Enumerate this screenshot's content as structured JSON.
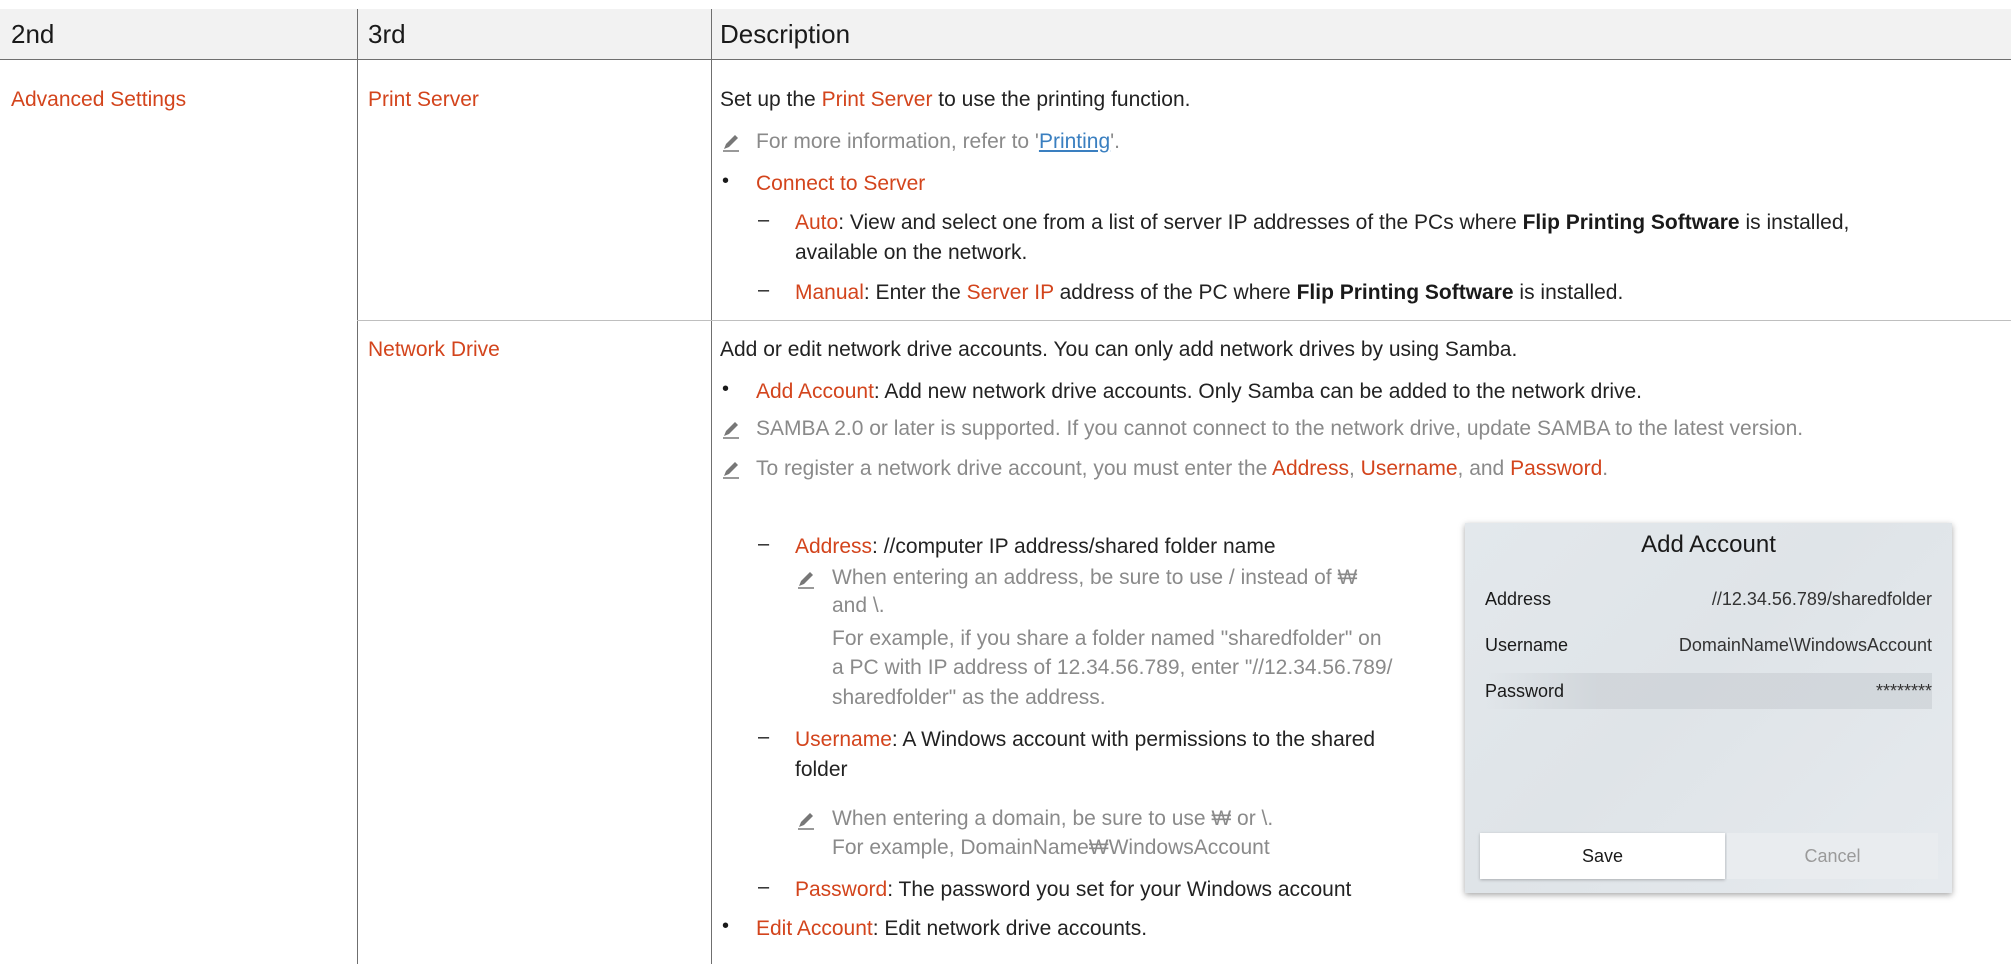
{
  "table": {
    "headers": {
      "col2": "2nd",
      "col3": "3rd",
      "col4": "Description"
    },
    "section": "Advanced Settings",
    "print_server": {
      "name": "Print Server",
      "intro_a": "Set up the ",
      "intro_hl": "Print Server",
      "intro_b": " to use the printing function.",
      "note_a": "For more information, refer to '",
      "note_link": "Printing",
      "note_b": "'.",
      "bullet": "Connect to Server",
      "auto_label": "Auto",
      "auto_a": ": View and select one from a list of server IP addresses of the PCs where ",
      "auto_bold": "Flip Printing Software",
      "auto_b": " is installed,",
      "auto_line2": "available on the network.",
      "manual_label": "Manual",
      "manual_a": ": Enter the ",
      "manual_hl": "Server IP",
      "manual_b": " address of the PC where ",
      "manual_bold": "Flip Printing Software",
      "manual_c": " is installed."
    },
    "network_drive": {
      "name": "Network Drive",
      "intro": "Add or edit network drive accounts. You can only add network drives by using Samba.",
      "add_label": "Add Account",
      "add_text": ": Add new network drive accounts. Only Samba can be added to the network drive.",
      "note1": "SAMBA 2.0 or later is supported. If you cannot connect to the network drive, update SAMBA to the latest version.",
      "note2_a": "To register a network drive account, you must enter the ",
      "note2_address": "Address",
      "note2_sep1": ", ",
      "note2_username": "Username",
      "note2_sep2": ", and ",
      "note2_password": "Password",
      "note2_end": ".",
      "address_label": "Address",
      "address_text": ": //computer IP address/shared folder name",
      "address_note_l1": "When entering an address, be sure to use / instead of ₩",
      "address_note_l2": "and \\.",
      "address_note_l3": "For example, if you share a folder named \"sharedfolder\" on",
      "address_note_l4": "a PC with IP address of 12.34.56.789, enter \"//12.34.56.789/",
      "address_note_l5": "sharedfolder\" as the address.",
      "username_label": "Username",
      "username_text": ": A Windows account with permissions to the shared",
      "username_line2": "folder",
      "username_note_l1": "When entering a domain, be sure to use ₩ or \\.",
      "username_note_l2": "For example, DomainName₩WindowsAccount",
      "password_label": "Password",
      "password_text": ": The password you set for your Windows account",
      "edit_label": "Edit Account",
      "edit_text": ": Edit network drive accounts."
    }
  },
  "dialog": {
    "title": "Add Account",
    "address_label": "Address",
    "address_value": "//12.34.56.789/sharedfolder",
    "username_label": "Username",
    "username_value": "DomainName\\WindowsAccount",
    "password_label": "Password",
    "password_value": "********",
    "save": "Save",
    "cancel": "Cancel"
  },
  "colors": {
    "highlight": "#d3441c",
    "note_gray": "#8a8a8a",
    "link": "#3a7fc0"
  },
  "icons": {
    "note": "pencil-note-icon",
    "bullet": "bullet-dot",
    "dash": "en-dash"
  }
}
